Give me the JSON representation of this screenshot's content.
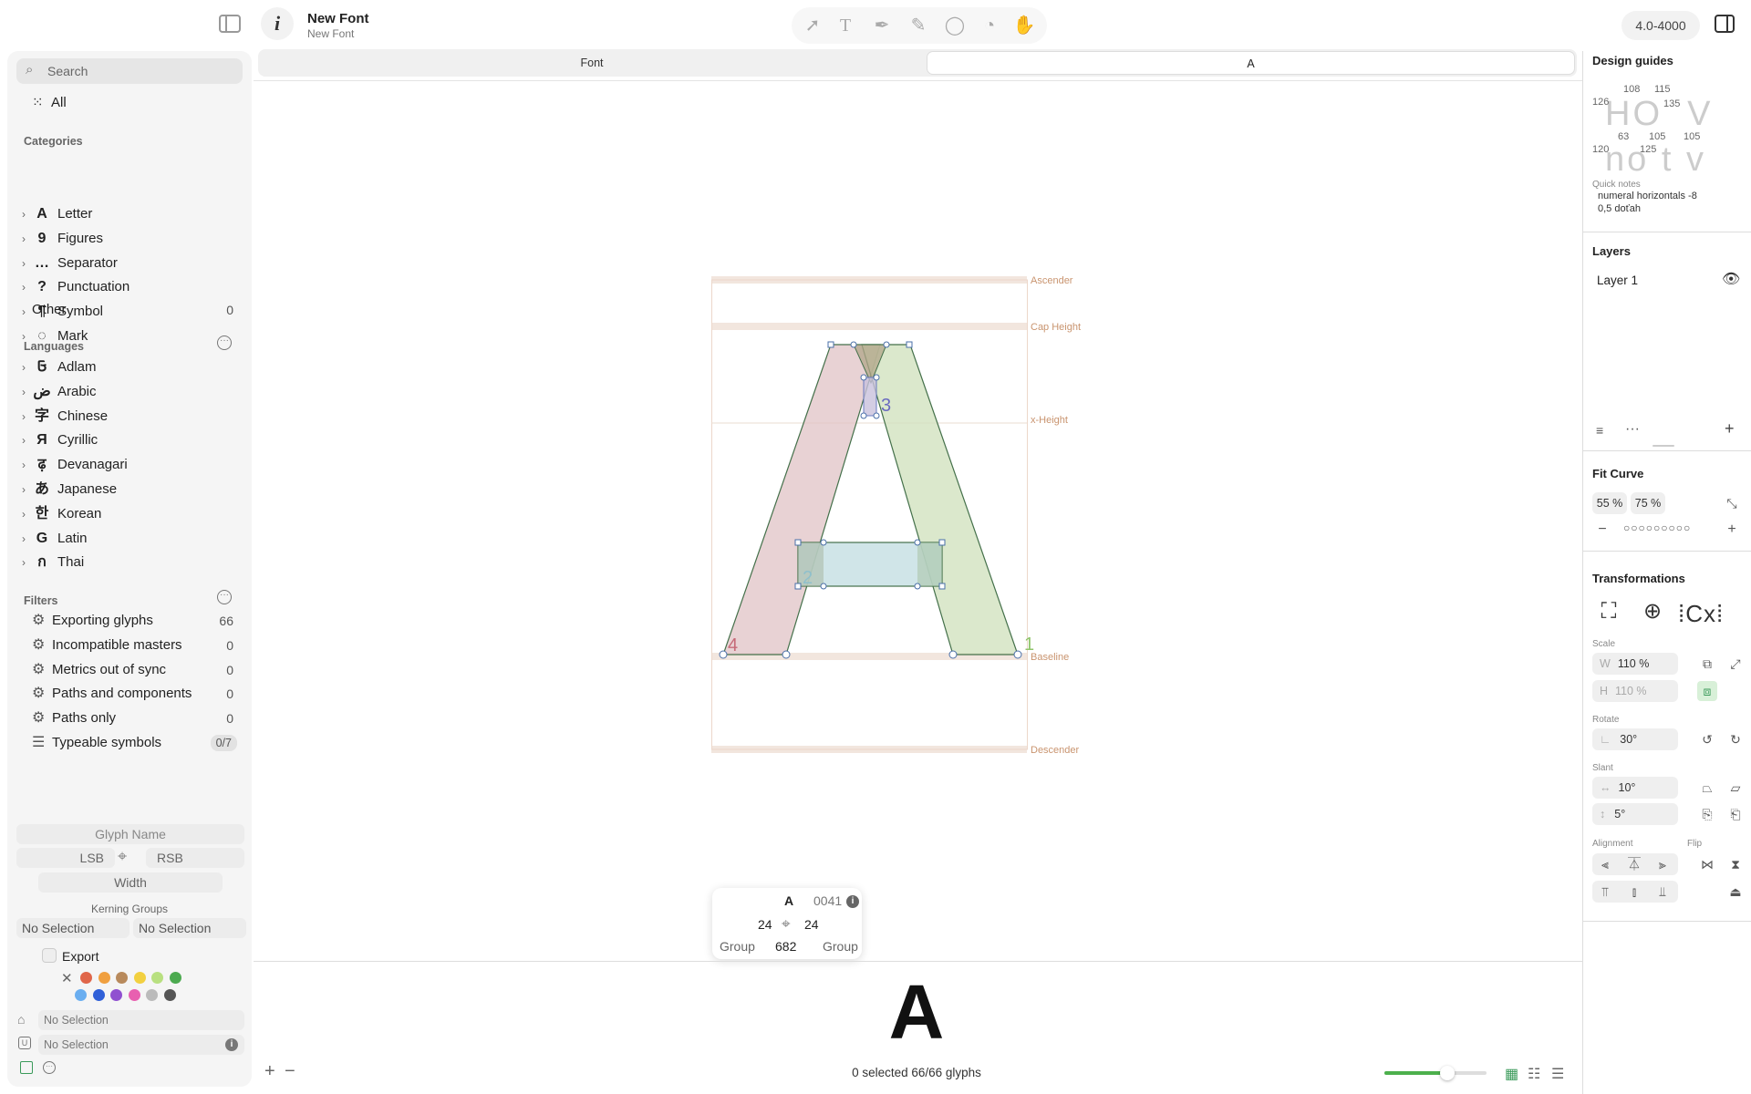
{
  "header": {
    "title": "New Font",
    "subtitle": "New Font",
    "version": "4.0-4000"
  },
  "tabs": [
    {
      "label": "Font",
      "active": false
    },
    {
      "label": "A",
      "active": true
    }
  ],
  "sidebar": {
    "search_placeholder": "Search",
    "all_label": "All",
    "categories_title": "Categories",
    "categories": [
      {
        "glyph": "A",
        "label": "Letter"
      },
      {
        "glyph": "9",
        "label": "Figures"
      },
      {
        "glyph": "…",
        "label": "Separator"
      },
      {
        "glyph": "?",
        "label": "Punctuation"
      },
      {
        "glyph": "¶",
        "label": "Symbol"
      },
      {
        "glyph": "◌",
        "label": "Mark"
      }
    ],
    "other_label": "Other",
    "other_count": "0",
    "languages_title": "Languages",
    "languages": [
      {
        "glyph": "𞤀",
        "label": "Adlam"
      },
      {
        "glyph": "ض",
        "label": "Arabic"
      },
      {
        "glyph": "字",
        "label": "Chinese"
      },
      {
        "glyph": "Я",
        "label": "Cyrillic"
      },
      {
        "glyph": "ढ़",
        "label": "Devanagari"
      },
      {
        "glyph": "あ",
        "label": "Japanese"
      },
      {
        "glyph": "한",
        "label": "Korean"
      },
      {
        "glyph": "G",
        "label": "Latin"
      },
      {
        "glyph": "ก",
        "label": "Thai"
      }
    ],
    "filters_title": "Filters",
    "filters": [
      {
        "label": "Exporting glyphs",
        "count": "66"
      },
      {
        "label": "Incompatible masters",
        "count": "0"
      },
      {
        "label": "Metrics out of sync",
        "count": "0"
      },
      {
        "label": "Paths and components",
        "count": "0"
      },
      {
        "label": "Paths only",
        "count": "0"
      },
      {
        "label": "Typeable symbols",
        "count": "0/7"
      }
    ],
    "glyph_name_placeholder": "Glyph Name",
    "lsb_label": "LSB",
    "rsb_label": "RSB",
    "width_label": "Width",
    "kerning_groups_label": "Kerning Groups",
    "kerning_left": "No Selection",
    "kerning_right": "No Selection",
    "export_label": "Export",
    "swatch_colors": [
      "#e0664a",
      "#f0a040",
      "#b88a5c",
      "#f2d040",
      "#b8e080",
      "#4caa50",
      "#6aaef0",
      "#3060d8",
      "#9050d0",
      "#e860b0",
      "#bbbbbb",
      "#555555"
    ],
    "tags_value": "No Selection",
    "unicode_value": "No Selection"
  },
  "canvas": {
    "metrics": {
      "ascender": "Ascender",
      "cap_height": "Cap Height",
      "x_height": "x-Height",
      "baseline": "Baseline",
      "descender": "Descender"
    },
    "shape_labels": [
      "3",
      "2",
      "4",
      "1"
    ]
  },
  "glyph_info": {
    "char": "A",
    "unicode": "0041",
    "lsb": "24",
    "rsb": "24",
    "width": "682",
    "left_group": "Group",
    "right_group": "Group"
  },
  "preview": {
    "char": "A",
    "status": "0 selected 66/66 glyphs",
    "zoom_fraction": 0.62
  },
  "right": {
    "design_guides_title": "Design guides",
    "guide_numbers_row1": [
      "126",
      "108",
      "115",
      "135"
    ],
    "guide_numbers_row2": [
      "63",
      "105",
      "105",
      "120",
      "125"
    ],
    "guide_text_row1": "HO  V",
    "guide_text_row2": "no t v",
    "quick_notes_label": "Quick notes",
    "quick_notes_line1": "numeral horizontals -8",
    "quick_notes_line2": "0,5 doťah",
    "layers_title": "Layers",
    "layer_name": "Layer 1",
    "fit_curve_title": "Fit Curve",
    "fit_min": "55 %",
    "fit_max": "75 %",
    "transformations_title": "Transformations",
    "scale_label": "Scale",
    "scale_w_label": "W",
    "scale_w": "110 %",
    "scale_h_label": "H",
    "scale_h": "110 %",
    "rotate_label": "Rotate",
    "rotate_value": "30°",
    "slant_label": "Slant",
    "slant_h": "10°",
    "slant_v": "5°",
    "alignment_label": "Alignment",
    "flip_label": "Flip"
  }
}
